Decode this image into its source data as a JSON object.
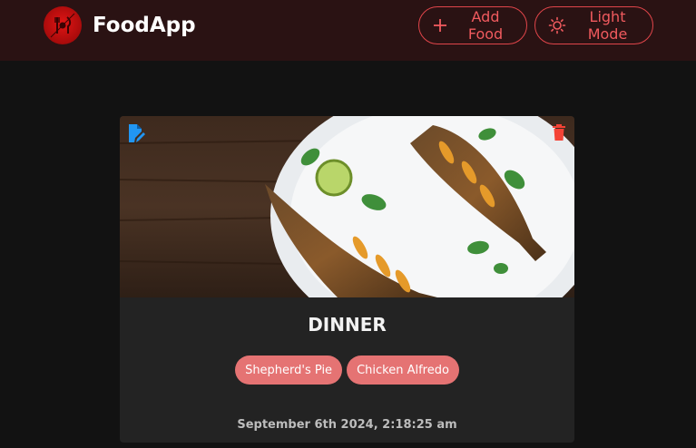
{
  "navbar": {
    "brand": "FoodApp",
    "add_food_label": "Add Food",
    "light_mode_label": "Light Mode"
  },
  "card": {
    "image_alt": "grilled fish on a plate",
    "title": "DINNER",
    "tags": [
      "Shepherd's Pie",
      "Chicken Alfredo"
    ],
    "date": "September 6th 2024, 2:18:25 am"
  },
  "colors": {
    "navbar_bg": "#2a1213",
    "page_bg": "#121212",
    "accent": "#e0454a",
    "chip_bg": "#e57373",
    "edit_icon": "#2196f3",
    "delete_icon": "#f44336"
  },
  "icons": {
    "logo": "fork-knife-logo-icon",
    "add": "plus-icon",
    "light_mode": "sun-icon",
    "edit": "edit-icon",
    "delete": "trash-icon"
  }
}
